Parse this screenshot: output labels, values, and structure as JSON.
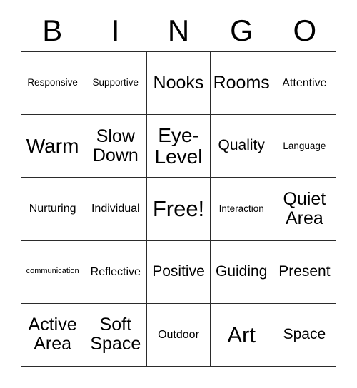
{
  "card": {
    "header_letters": [
      "B",
      "I",
      "N",
      "G",
      "O"
    ],
    "rows": [
      [
        {
          "text": "Responsive",
          "size": "s"
        },
        {
          "text": "Supportive",
          "size": "s"
        },
        {
          "text": "Nooks",
          "size": "xl"
        },
        {
          "text": "Rooms",
          "size": "xl"
        },
        {
          "text": "Attentive",
          "size": "m"
        }
      ],
      [
        {
          "text": "Warm",
          "size": "xxl"
        },
        {
          "text": "Slow\nDown",
          "size": "xl"
        },
        {
          "text": "Eye-\nLevel",
          "size": "xxl"
        },
        {
          "text": "Quality",
          "size": "l"
        },
        {
          "text": "Language",
          "size": "s"
        }
      ],
      [
        {
          "text": "Nurturing",
          "size": "m"
        },
        {
          "text": "Individual",
          "size": "m"
        },
        {
          "text": "Free!",
          "size": "free"
        },
        {
          "text": "Interaction",
          "size": "s"
        },
        {
          "text": "Quiet\nArea",
          "size": "xl"
        }
      ],
      [
        {
          "text": "communication",
          "size": "xs"
        },
        {
          "text": "Reflective",
          "size": "m"
        },
        {
          "text": "Positive",
          "size": "l"
        },
        {
          "text": "Guiding",
          "size": "l"
        },
        {
          "text": "Present",
          "size": "l"
        }
      ],
      [
        {
          "text": "Active\nArea",
          "size": "xl"
        },
        {
          "text": "Soft\nSpace",
          "size": "xl"
        },
        {
          "text": "Outdoor",
          "size": "m"
        },
        {
          "text": "Art",
          "size": "free"
        },
        {
          "text": "Space",
          "size": "l"
        }
      ]
    ]
  },
  "colors": {
    "background": "#ffffff",
    "text": "#000000",
    "grid_line": "#2b2b2b"
  }
}
